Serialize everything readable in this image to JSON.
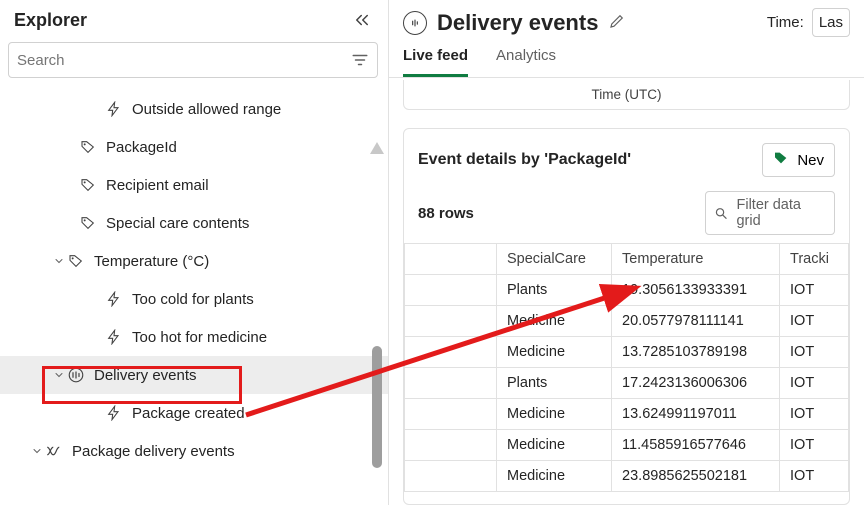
{
  "sidebar": {
    "title": "Explorer",
    "search_placeholder": "Search",
    "items": {
      "outside_range": "Outside allowed range",
      "packageid": "PackageId",
      "recipient_email": "Recipient email",
      "special_care": "Special care contents",
      "temperature": "Temperature (°C)",
      "too_cold": "Too cold for plants",
      "too_hot": "Too hot for medicine",
      "delivery_events": "Delivery events",
      "package_created": "Package created",
      "package_delivery_events": "Package delivery events"
    }
  },
  "header": {
    "title": "Delivery events",
    "time_label": "Time:",
    "time_value": "Las"
  },
  "tabs": {
    "live_feed": "Live feed",
    "analytics": "Analytics"
  },
  "time_utc_label": "Time (UTC)",
  "card": {
    "title": "Event details by 'PackageId'",
    "new_label": "Nev",
    "rows_count": "88 rows",
    "filter_placeholder": "Filter data grid"
  },
  "table": {
    "columns": [
      "",
      "SpecialCare",
      "Temperature",
      "Tracki"
    ],
    "rows": [
      [
        "",
        "Plants",
        "19.3056133933391",
        "IOT"
      ],
      [
        "",
        "Medicine",
        "20.0577978111141",
        "IOT"
      ],
      [
        "",
        "Medicine",
        "13.7285103789198",
        "IOT"
      ],
      [
        "",
        "Plants",
        "17.2423136006306",
        "IOT"
      ],
      [
        "",
        "Medicine",
        "13.624991197011",
        "IOT"
      ],
      [
        "",
        "Medicine",
        "11.4585916577646",
        "IOT"
      ],
      [
        "",
        "Medicine",
        "23.8985625502181",
        "IOT"
      ]
    ]
  }
}
